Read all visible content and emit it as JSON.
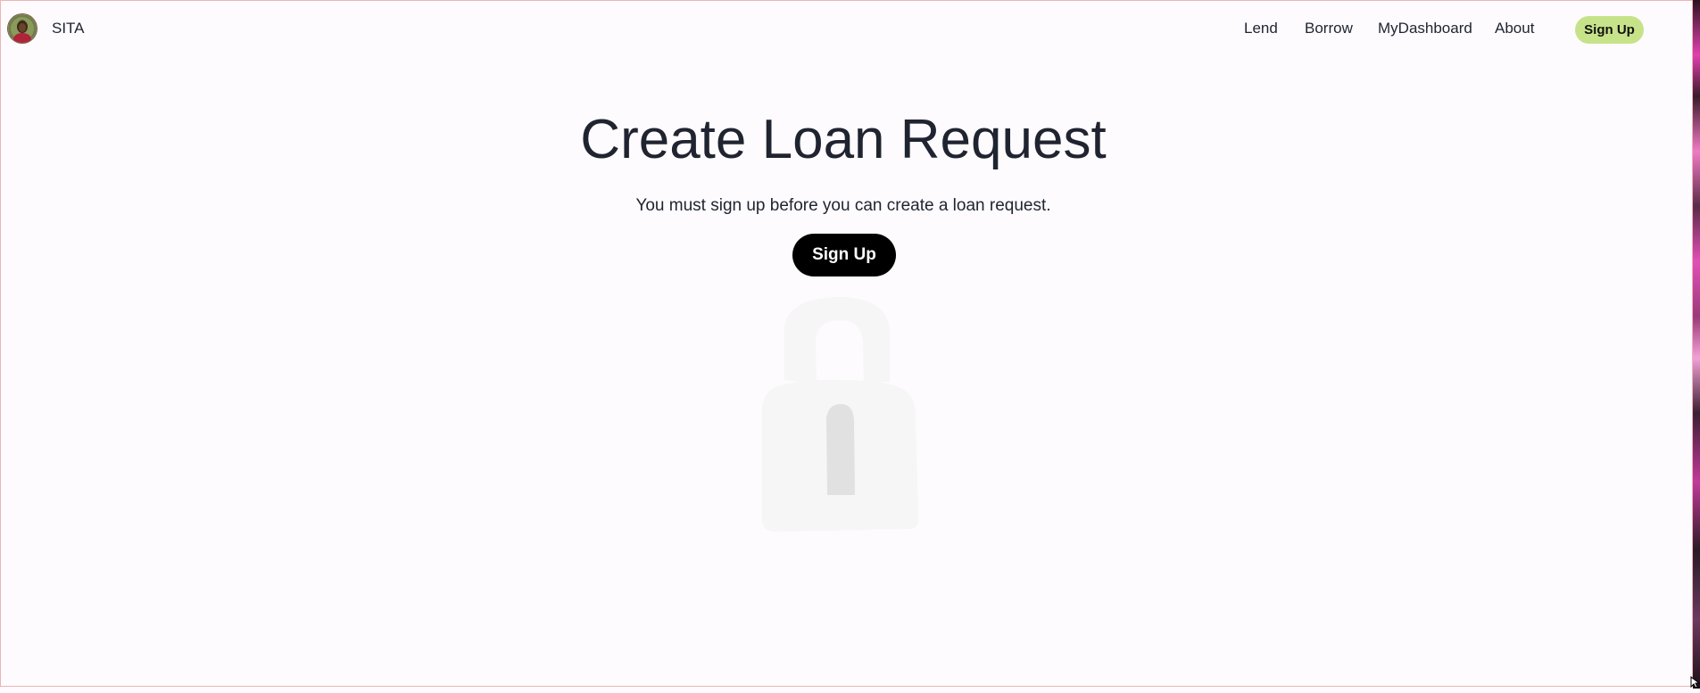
{
  "header": {
    "brand": "SITA",
    "nav": {
      "lend": "Lend",
      "borrow": "Borrow",
      "dashboard": "MyDashboard",
      "about": "About",
      "signup": "Sign Up"
    }
  },
  "main": {
    "title": "Create Loan Request",
    "message": "You must sign up before you can create a loan request.",
    "signup_button": "Sign Up"
  },
  "icons": {
    "logo": "avatar-logo",
    "illustration": "lock-icon"
  },
  "colors": {
    "nav_signup_bg": "#c7e38a",
    "main_signup_bg": "#000000",
    "text": "#1f2430",
    "background": "#fdfbfd"
  }
}
